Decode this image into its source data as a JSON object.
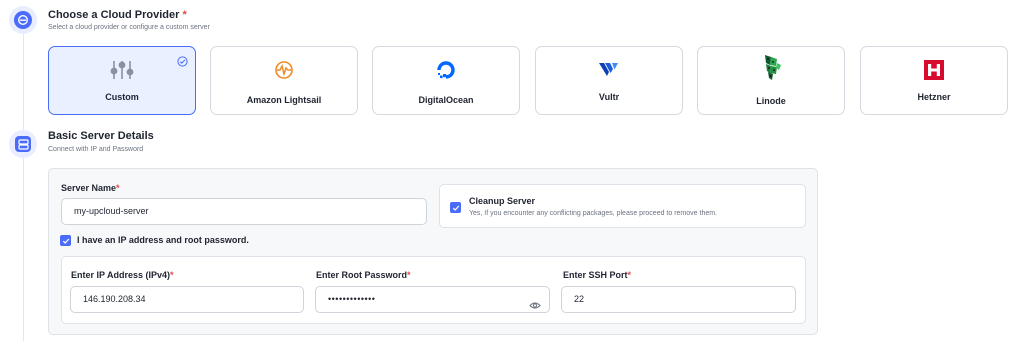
{
  "section1": {
    "title": "Choose a Cloud Provider",
    "required_mark": "*",
    "subtitle": "Select a cloud provider or configure a custom server"
  },
  "providers": [
    {
      "label": "Custom",
      "selected": true,
      "icon": "sliders-icon"
    },
    {
      "label": "Amazon Lightsail",
      "selected": false,
      "icon": "lightsail-logo-icon"
    },
    {
      "label": "DigitalOcean",
      "selected": false,
      "icon": "digitalocean-logo-icon"
    },
    {
      "label": "Vultr",
      "selected": false,
      "icon": "vultr-logo-icon"
    },
    {
      "label": "Linode",
      "selected": false,
      "icon": "linode-logo-icon"
    },
    {
      "label": "Hetzner",
      "selected": false,
      "icon": "hetzner-logo-icon"
    }
  ],
  "section2": {
    "title": "Basic Server Details",
    "subtitle": "Connect with IP and Password"
  },
  "form": {
    "server_name_label": "Server Name",
    "server_name_value": "my-upcloud-server",
    "cleanup_title": "Cleanup Server",
    "cleanup_desc": "Yes, If you encounter any conflicting packages, please proceed to remove them.",
    "cleanup_checked": true,
    "ip_checkbox_label": "I have an IP address and root password.",
    "ip_checkbox_checked": true,
    "ip_label": "Enter IP Address (IPv4)",
    "ip_value": "146.190.208.34",
    "password_label": "Enter Root Password",
    "password_value": "•••••••••••••",
    "port_label": "Enter SSH Port",
    "port_value": "22"
  },
  "colors": {
    "accent": "#4b6cfb",
    "required": "#e5484d",
    "selected_bg": "#e9f0ff"
  }
}
